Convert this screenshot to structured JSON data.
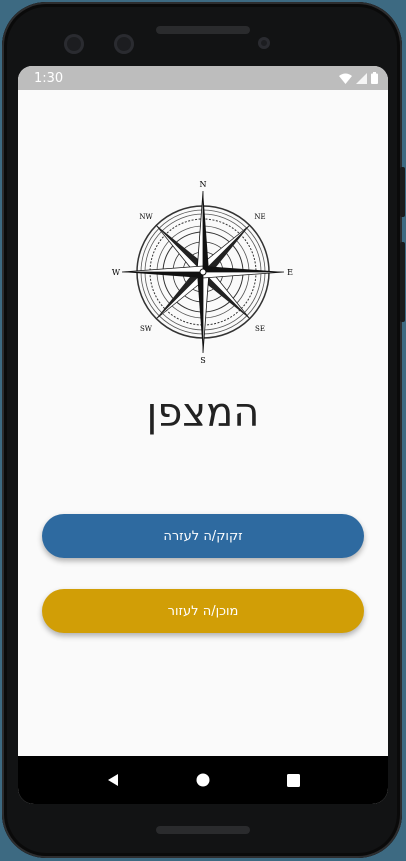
{
  "status_bar": {
    "time": "1:30",
    "icons": [
      "wifi-icon",
      "signal-icon",
      "battery-icon"
    ]
  },
  "compass": {
    "icon": "compass-rose-icon",
    "directions": {
      "n": "N",
      "ne": "NE",
      "e": "E",
      "se": "SE",
      "s": "S",
      "sw": "SW",
      "w": "W",
      "nw": "NW"
    }
  },
  "app": {
    "title": "המצפן",
    "need_help_label": "זקוק/ה לעזרה",
    "ready_help_label": "מוכן/ה לעזור"
  },
  "nav_bar": {
    "icons": [
      "back-icon",
      "home-icon",
      "recents-icon"
    ]
  },
  "colors": {
    "need_help_button": "#2e6aa0",
    "ready_help_button": "#d19e06",
    "status_bar": "#bdbdbd",
    "background": "#fafafa"
  }
}
